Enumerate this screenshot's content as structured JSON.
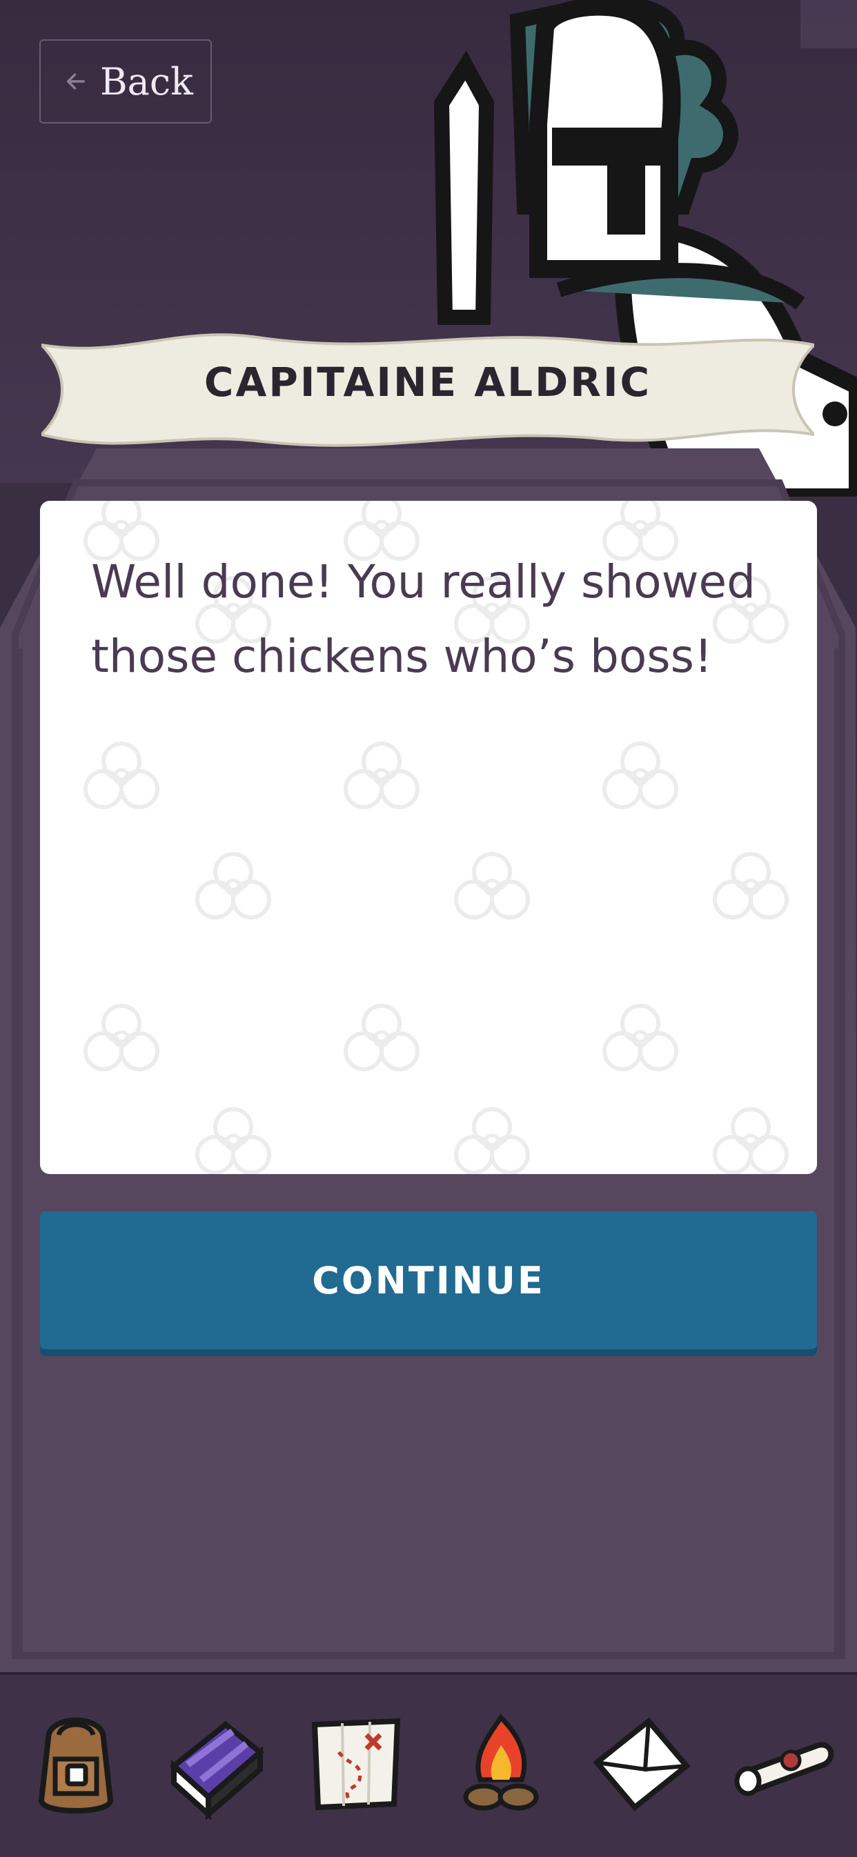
{
  "header": {
    "back_label": "Back",
    "back_icon": "arrow-left-icon"
  },
  "speaker": {
    "name": "CAPITAINE ALDRIC"
  },
  "dialog": {
    "text": "Well done! You really showed those chickens who’s boss!"
  },
  "actions": {
    "continue_label": "CONTINUE"
  },
  "toolbar": {
    "items": [
      {
        "icon": "backpack-icon"
      },
      {
        "icon": "book-icon"
      },
      {
        "icon": "treasure-map-icon"
      },
      {
        "icon": "campfire-icon"
      },
      {
        "icon": "envelope-icon"
      },
      {
        "icon": "scroll-icon"
      }
    ]
  },
  "colors": {
    "background": "#3a2e42",
    "panel": "#56475f",
    "button": "#216a91",
    "banner": "#eeebe0",
    "text": "#4a3a52"
  }
}
